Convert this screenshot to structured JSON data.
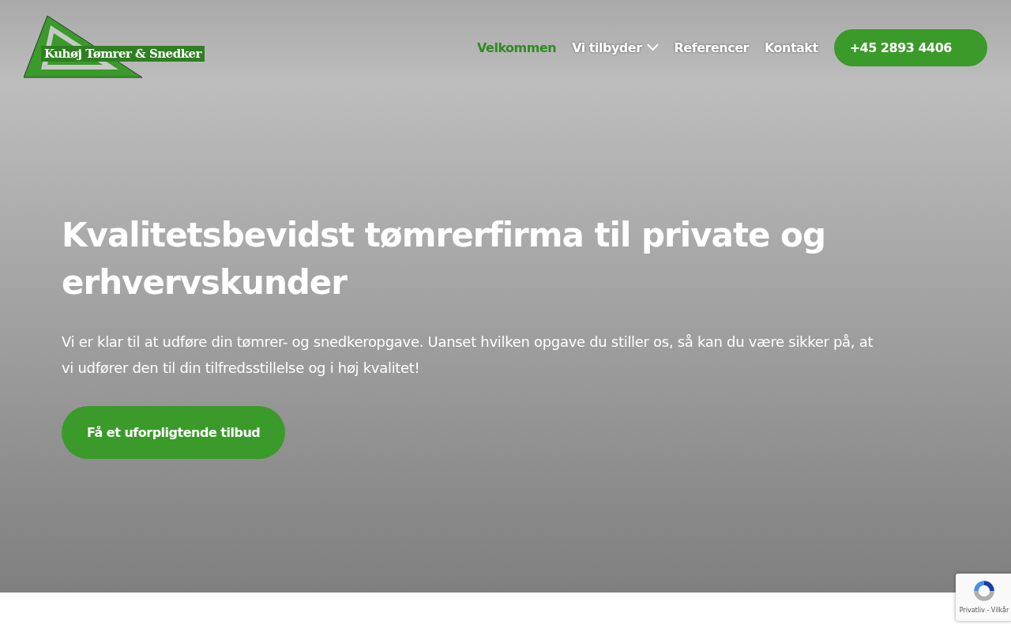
{
  "logo": {
    "text": "Kuhøj Tømrer & Snedker"
  },
  "nav": [
    {
      "label": "Velkommen",
      "selected": true,
      "dropdown": false
    },
    {
      "label": "Vi tilbyder",
      "selected": false,
      "dropdown": true
    },
    {
      "label": "Referencer",
      "selected": false,
      "dropdown": false
    },
    {
      "label": "Kontakt",
      "selected": false,
      "dropdown": false
    }
  ],
  "phone_button": "+45 2893 4406",
  "hero": {
    "title": "Kvalitetsbevidst tømrerfirma til private og erhvervskunder",
    "text": "Vi er klar til at udføre din tømrer- og snedkeropgave. Uanset hvilken opgave du stiller os, så kan du være sikker på, at vi udfører den til din tilfredsstillelse og i høj kvalitet!",
    "button": "Få et uforpligtende tilbud"
  },
  "recaptcha": {
    "text": "Privatliv - Vilkår"
  }
}
